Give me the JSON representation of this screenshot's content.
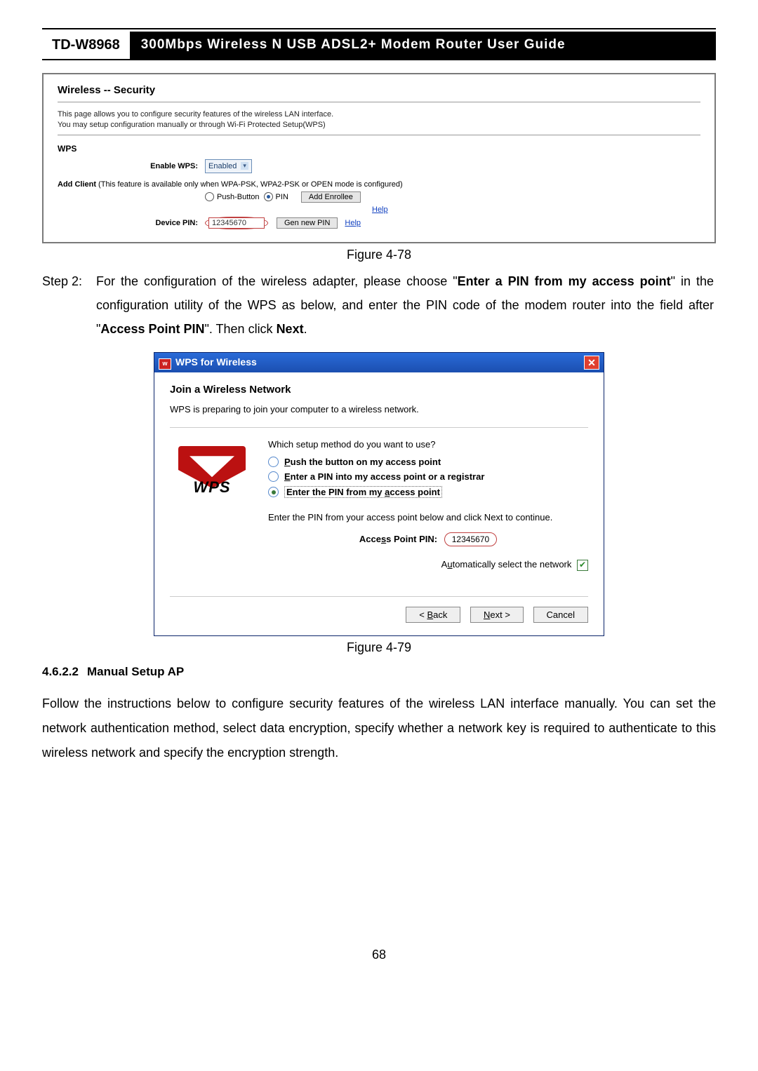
{
  "header": {
    "model": "TD-W8968",
    "title": "300Mbps Wireless N USB ADSL2+ Modem Router User Guide"
  },
  "fig78": {
    "title": "Wireless -- Security",
    "desc1": "This page allows you to configure security features of the wireless LAN interface.",
    "desc2": "You may setup configuration manually or through Wi-Fi Protected Setup(WPS)",
    "wps": "WPS",
    "enable_label": "Enable WPS:",
    "enable_value": "Enabled",
    "addclient_pre": "Add Client",
    "addclient_rest": " (This feature is available only when WPA-PSK, WPA2-PSK or OPEN mode is configured)",
    "pushbtn": "Push-Button",
    "pin": "PIN",
    "add_enrollee": "Add Enrollee",
    "help": "Help",
    "device_pin_label": "Device PIN:",
    "device_pin": "12345670",
    "gen_new": "Gen new PIN",
    "caption": "Figure 4-78"
  },
  "step2": {
    "label": "Step 2:",
    "t1": "For the configuration of the wireless adapter, please choose \"",
    "b1": "Enter a PIN from my access point",
    "t2": "\" in the configuration utility of the WPS as below, and enter the PIN code of the modem router into the field after \"",
    "b2": "Access Point PIN",
    "t3": "\". Then click ",
    "b3": "Next",
    "t4": "."
  },
  "fig79": {
    "titlebar": "WPS for Wireless",
    "heading": "Join a Wireless Network",
    "sub": "WPS is preparing to join your computer to a wireless network.",
    "question": "Which setup method do you want to use?",
    "opt1_pre": "P",
    "opt1_rest": "ush the button on my access point",
    "opt2_pre": "E",
    "opt2_rest": "nter a PIN into my access point or a registrar",
    "opt3_pre": "Enter the PIN from my ",
    "opt3_u": "a",
    "opt3_post": "ccess point",
    "hint": "Enter the PIN from your access point below and click Next to continue.",
    "pin_label_pre": "Acce",
    "pin_label_u": "s",
    "pin_label_post": "s Point PIN:",
    "pin_value": "12345670",
    "auto_pre": "A",
    "auto_u": "u",
    "auto_post": "tomatically select the network",
    "back_pre": "< ",
    "back_u": "B",
    "back_post": "ack",
    "next_u": "N",
    "next_post": "ext >",
    "cancel": "Cancel",
    "caption": "Figure 4-79",
    "logo": "WPS"
  },
  "sec": {
    "num": "4.6.2.2",
    "title": "Manual Setup AP"
  },
  "para": "Follow the instructions below to configure security features of the wireless LAN interface manually. You can set the network authentication method, select data encryption, specify whether a network key is required to authenticate to this wireless network and specify the encryption strength.",
  "pagenum": "68"
}
